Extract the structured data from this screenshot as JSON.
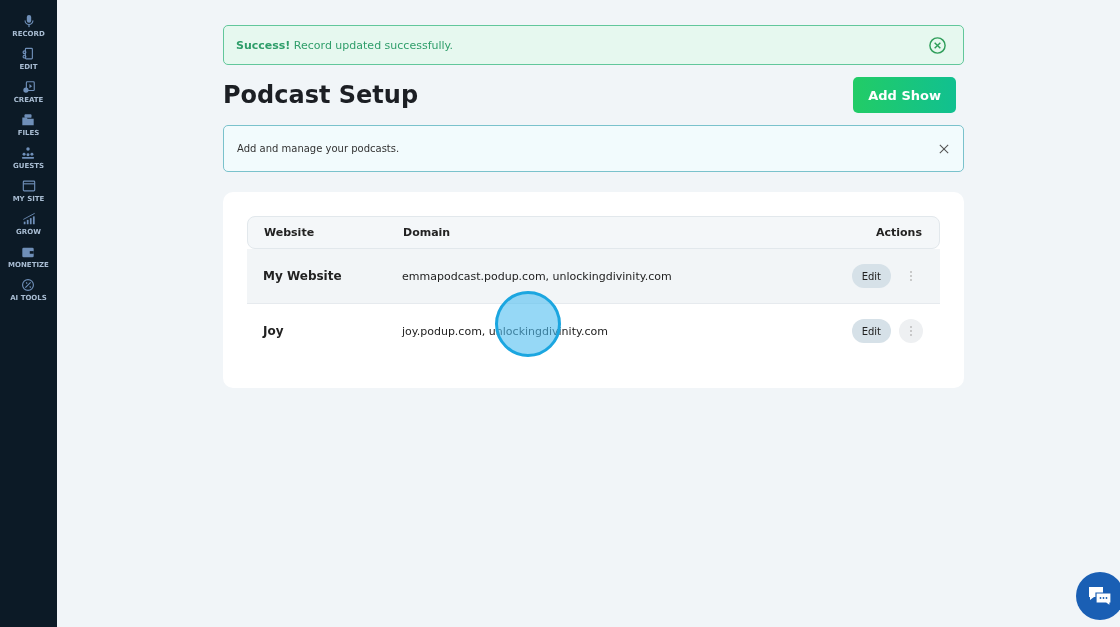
{
  "sidebar": {
    "items": [
      {
        "label": "RECORD"
      },
      {
        "label": "EDIT"
      },
      {
        "label": "CREATE"
      },
      {
        "label": "FILES"
      },
      {
        "label": "GUESTS"
      },
      {
        "label": "MY SITE"
      },
      {
        "label": "GROW"
      },
      {
        "label": "MONETIZE"
      },
      {
        "label": "AI TOOLS"
      }
    ]
  },
  "alert": {
    "strong": "Success!",
    "text": "Record updated successfully."
  },
  "page_title": "Podcast Setup",
  "add_button": "Add Show",
  "info": {
    "text": "Add and manage your podcasts."
  },
  "table": {
    "columns": [
      "Website",
      "Domain",
      "Actions"
    ],
    "rows": [
      {
        "website": "My Website",
        "domain": "emmapodcast.podup.com, unlockingdivinity.com",
        "action": "Edit",
        "selected": true
      },
      {
        "website": "Joy",
        "domain": "joy.podup.com, unlockingdivinity.com",
        "action": "Edit",
        "selected": false
      }
    ]
  }
}
